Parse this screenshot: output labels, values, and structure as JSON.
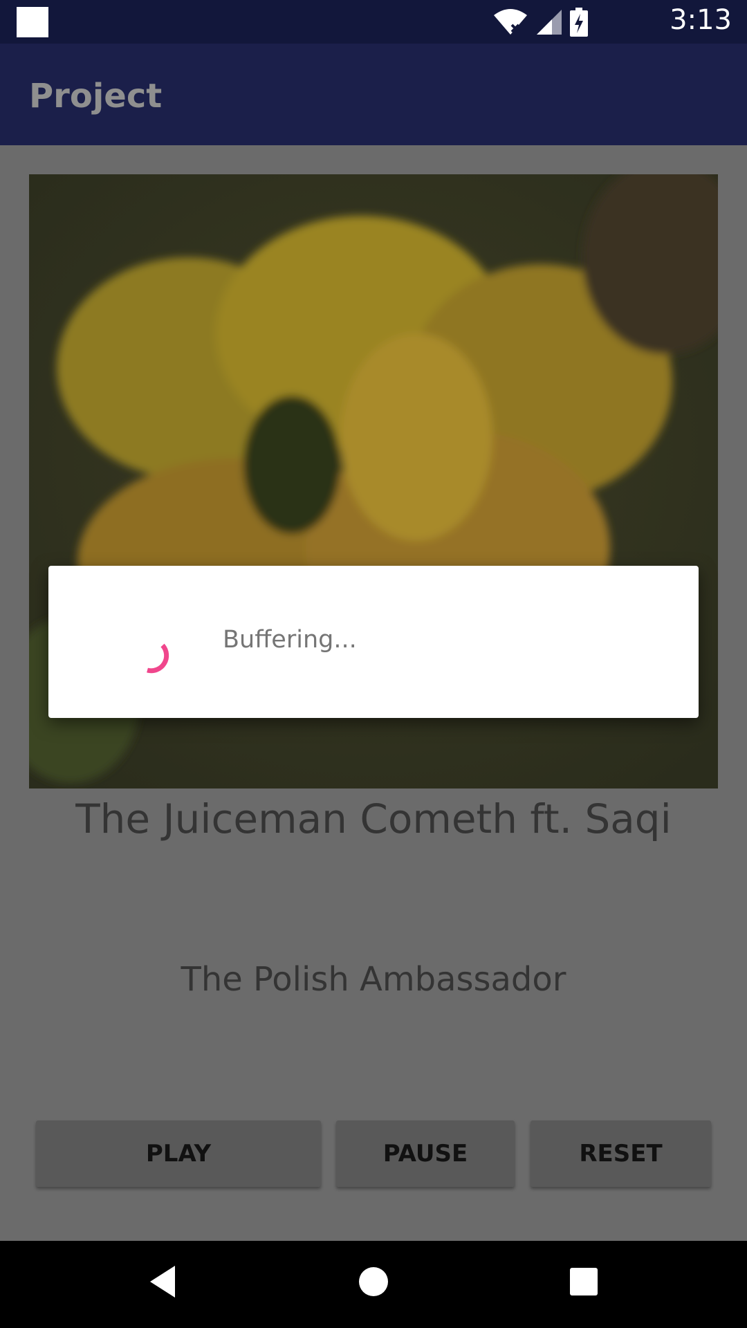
{
  "status_bar": {
    "time": "3:13",
    "icons": [
      "notification-square-icon",
      "wifi-x-icon",
      "signal-icon",
      "battery-charging-icon"
    ]
  },
  "app_bar": {
    "title": "Project"
  },
  "player": {
    "album_art": "yellow-flower-image",
    "song_title": "The Juiceman Cometh ft. Saqi",
    "artist": "The Polish Ambassador",
    "buttons": {
      "play": "PLAY",
      "pause": "PAUSE",
      "reset": "RESET"
    }
  },
  "dialog": {
    "message": "Buffering...",
    "spinner_color": "#f0468c"
  },
  "nav_bar": {
    "icons": [
      "back-icon",
      "home-icon",
      "recents-icon"
    ]
  },
  "colors": {
    "status_bar": "#12173b",
    "app_bar": "#1b1f4a",
    "dim_background": "#6b6b6b"
  }
}
